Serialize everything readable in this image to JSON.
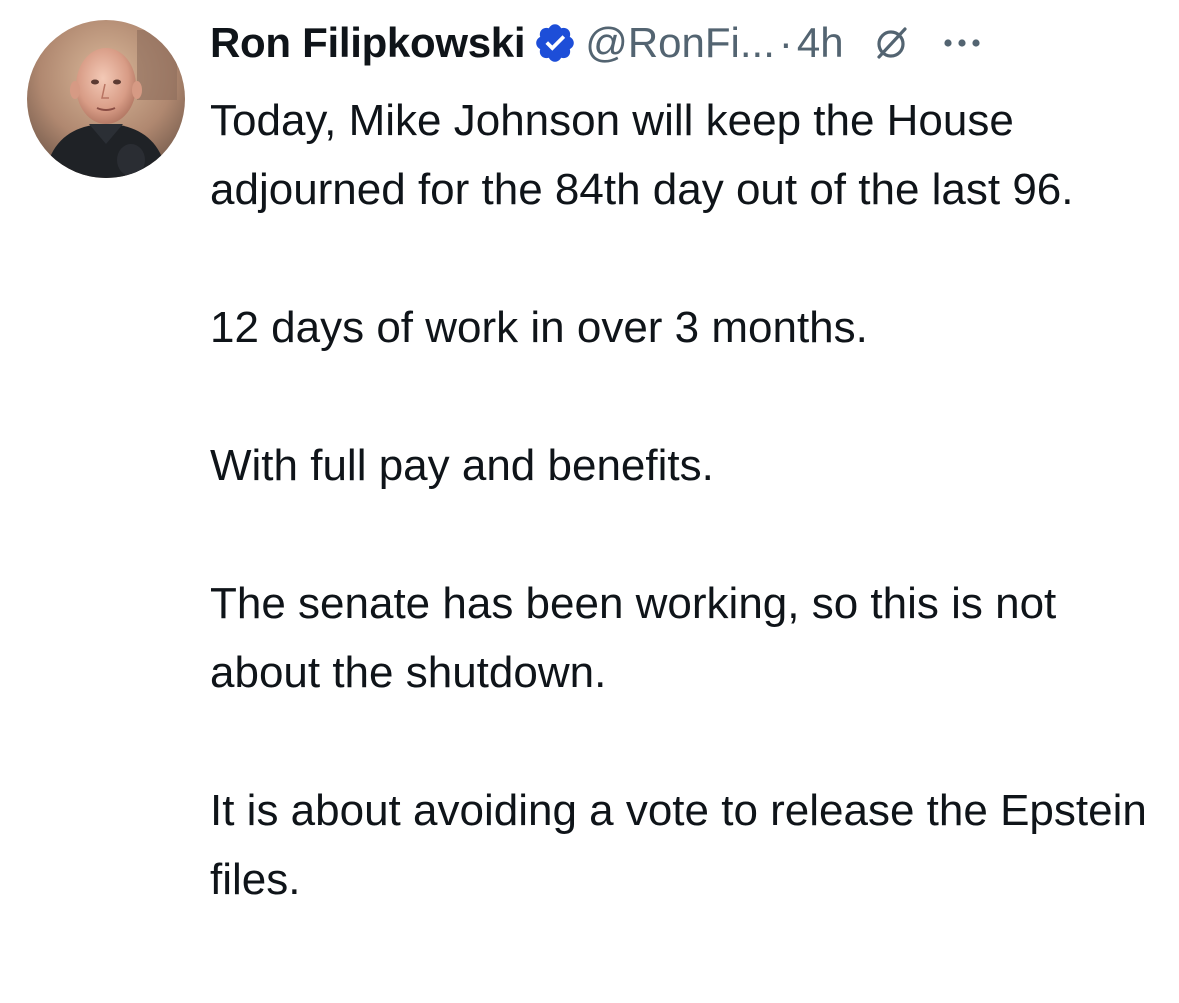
{
  "tweet": {
    "author": {
      "display_name": "Ron Filipkowski",
      "handle": "@RonFi...",
      "verified": true,
      "avatar_icon": "profile-photo"
    },
    "separator": "·",
    "timestamp": "4h",
    "icons": {
      "verified": "verified-badge-icon",
      "grok": "grok-icon",
      "more": "more-options-icon"
    },
    "colors": {
      "text": "#0f1419",
      "secondary": "#536471",
      "verified_badge": "#1d4ed8"
    },
    "body": [
      "Today, Mike Johnson will keep the House adjourned for the 84th day out of the last 96.",
      "12 days of work in over 3 months.",
      "With full pay and benefits.",
      "The senate has been working, so this is not about the shutdown.",
      "It is about avoiding a vote to release the Epstein files."
    ]
  }
}
